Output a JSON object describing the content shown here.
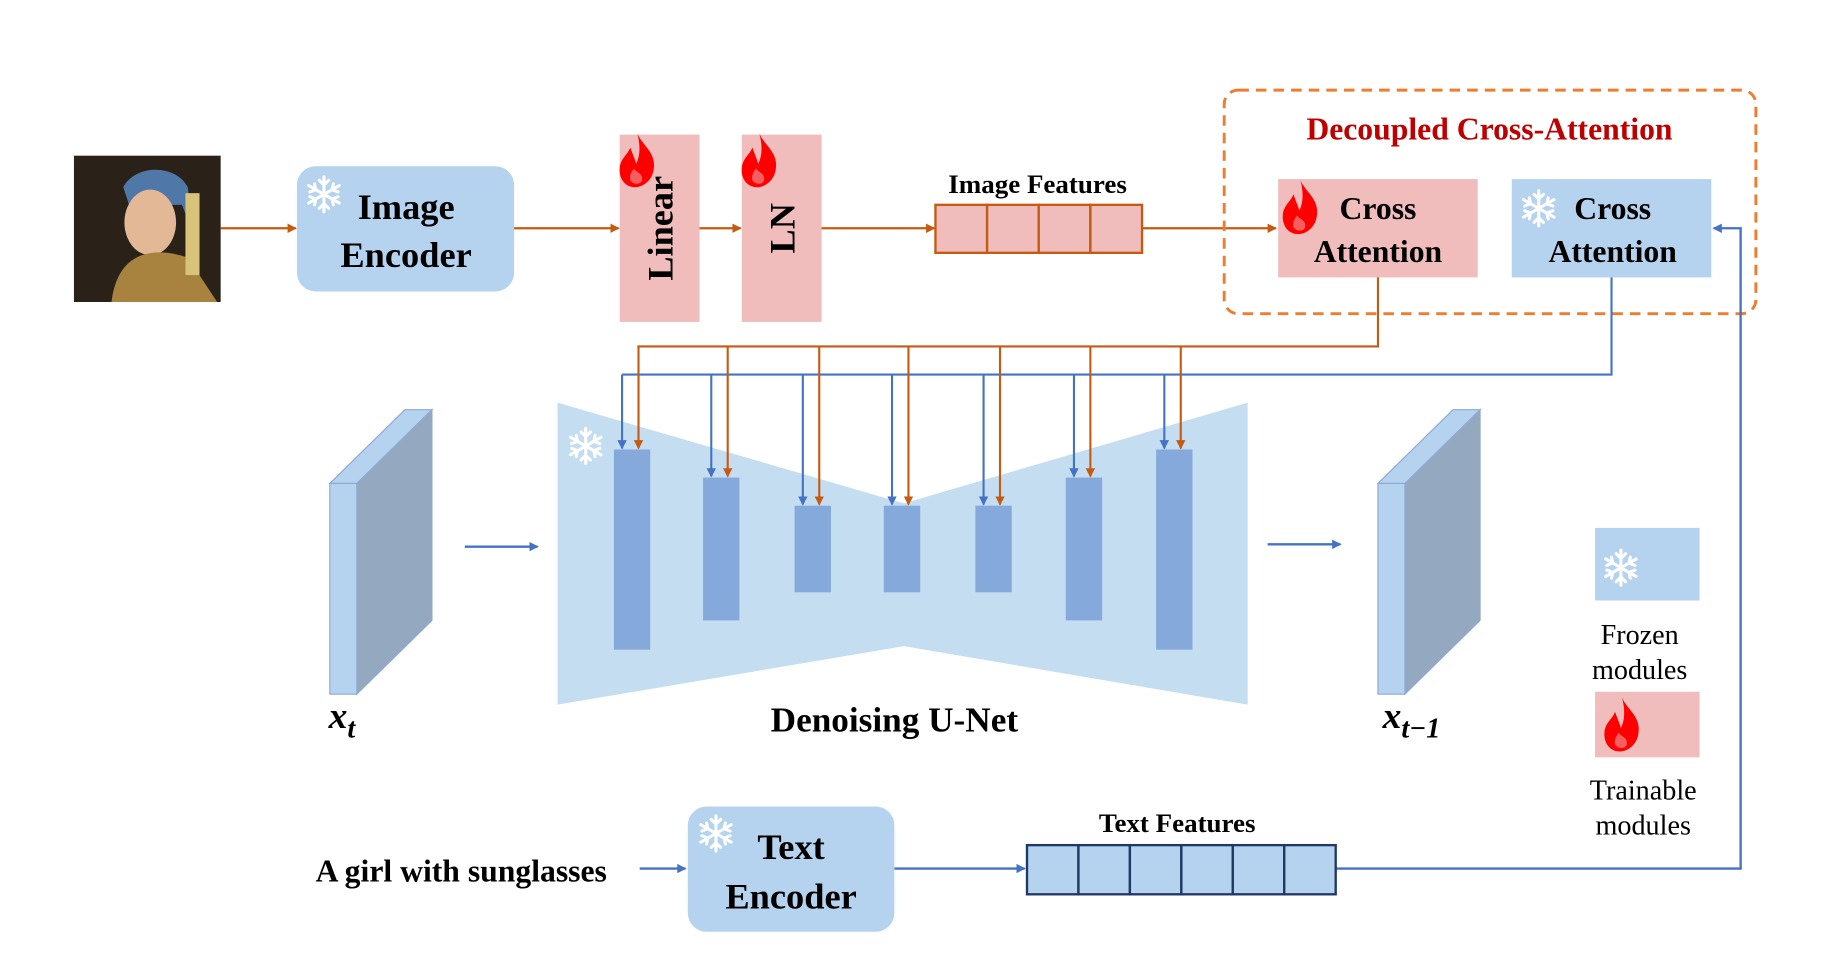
{
  "colors": {
    "frozen_fill": "#b5d3ee",
    "trainable_fill": "#f0bcbc",
    "image_path": "#c55a11",
    "text_path": "#4472c4",
    "unet_fill": "#c5ddf0",
    "unet_block": "#85a9db",
    "title_red": "#c00000"
  },
  "image_encoder": {
    "line1": "Image",
    "line2": "Encoder",
    "icon": "snowflake-icon"
  },
  "linear": {
    "label": "Linear",
    "icon": "flame-icon"
  },
  "ln": {
    "label": "LN",
    "icon": "flame-icon"
  },
  "image_features": {
    "label": "Image Features",
    "cells": 4
  },
  "decoupled": {
    "title": "Decoupled Cross-Attention",
    "trainable": {
      "line1": "Cross",
      "line2": "Attention",
      "icon": "flame-icon"
    },
    "frozen": {
      "line1": "Cross",
      "line2": "Attention",
      "icon": "snowflake-icon"
    }
  },
  "unet": {
    "label": "Denoising U-Net",
    "icon": "snowflake-icon"
  },
  "latents": {
    "input": {
      "base": "x",
      "sub": "t"
    },
    "output": {
      "base": "x",
      "sub": "t−1"
    }
  },
  "legend": {
    "frozen": {
      "line1": "Frozen",
      "line2": "modules"
    },
    "trainable": {
      "line1": "Trainable",
      "line2": "modules"
    }
  },
  "prompt": "A girl with sunglasses",
  "text_encoder": {
    "line1": "Text",
    "line2": "Encoder",
    "icon": "snowflake-icon"
  },
  "text_features": {
    "label": "Text Features",
    "cells": 6
  }
}
